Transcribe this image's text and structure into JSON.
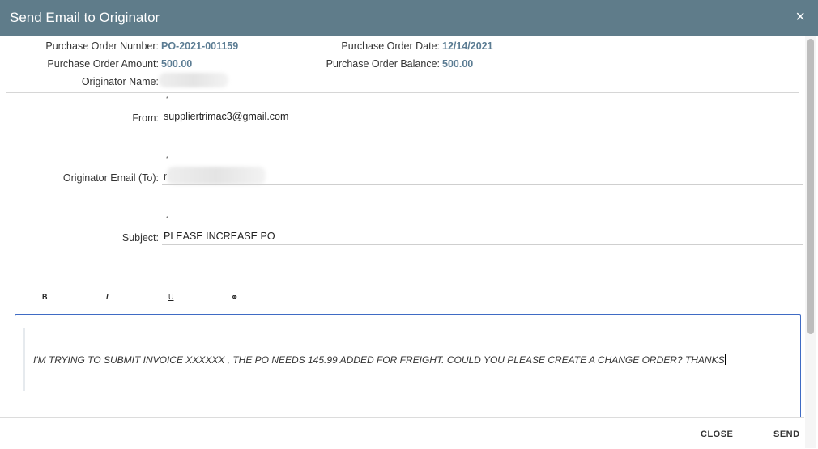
{
  "dialog": {
    "title": "Send Email to Originator",
    "close_icon": "×"
  },
  "info": {
    "po_number_label": "Purchase Order Number:",
    "po_number_value": "PO-2021-001159",
    "po_date_label": "Purchase Order Date:",
    "po_date_value": "12/14/2021",
    "po_amount_label": "Purchase Order Amount:",
    "po_amount_value": "500.00",
    "po_balance_label": "Purchase Order Balance:",
    "po_balance_value": "500.00",
    "originator_name_label": "Originator Name:"
  },
  "form": {
    "required_marker": "*",
    "from_label": "From:",
    "from_value": "suppliertrimac3@gmail.com",
    "to_label": "Originator Email (To):",
    "to_value_prefix": "r",
    "subject_label": "Subject:",
    "subject_value": "PLEASE INCREASE PO"
  },
  "toolbar": {
    "bold": "B",
    "italic": "I",
    "underline": "U",
    "link": "⚭"
  },
  "editor": {
    "body": "I'M TRYING TO SUBMIT INVOICE XXXXXX , THE PO NEEDS 145.99 ADDED FOR FREIGHT.  COULD YOU PLEASE CREATE A CHANGE ORDER? THANKS"
  },
  "footer": {
    "close_label": "CLOSE",
    "send_label": "SEND"
  },
  "colors": {
    "header_bg": "#5f7c8a",
    "value_text": "#5b7c93",
    "editor_border": "#3f6bc4"
  }
}
